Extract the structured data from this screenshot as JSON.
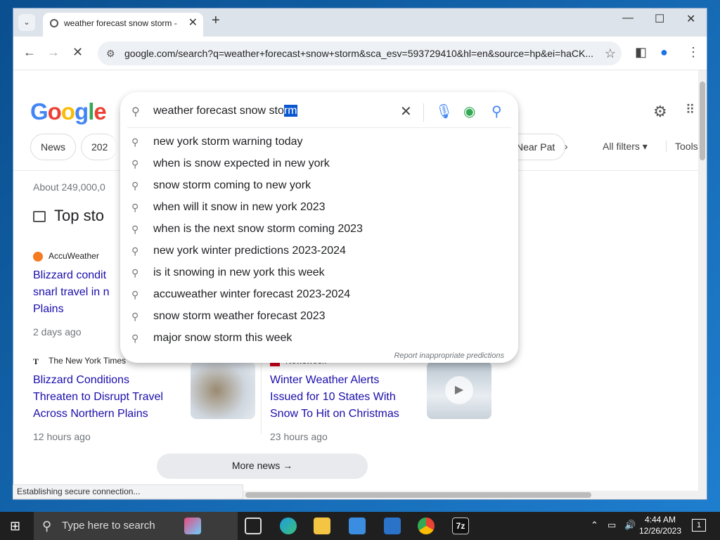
{
  "browser": {
    "tab_title": "weather forecast snow storm -",
    "tab_close": "✕",
    "new_tab": "+",
    "url": "google.com/search?q=weather+forecast+snow+storm&sca_esv=593729410&hl=en&source=hp&ei=haCK..."
  },
  "google": {
    "logo": "Google",
    "query_prefix": "weather forecast snow sto",
    "query_selected": "rm",
    "chips": [
      "News",
      "202"
    ],
    "chip_right": "Near Pat",
    "all_filters": "All filters",
    "tools": "Tools",
    "stats": "About 249,000,0",
    "top_stories": "Top sto",
    "suggestions": [
      "new york storm warning today",
      "when is snow expected in new york",
      "snow storm coming to new york",
      "when will it snow in new york 2023",
      "when is the next snow storm coming 2023",
      "new york winter predictions 2023-2024",
      "is it snowing in new york this week",
      "accuweather winter forecast 2023-2024",
      "snow storm weather forecast 2023",
      "major snow storm this week"
    ],
    "report": "Report inappropriate predictions",
    "stories": [
      {
        "source": "AccuWeather",
        "headline": "Blizzard condit snarl travel in n Plains",
        "age": "2 days ago"
      },
      {
        "source": "The New York Times",
        "headline": "Blizzard Conditions Threaten to Disrupt Travel Across Northern Plains",
        "age": "12 hours ago"
      },
      {
        "source": "Newsweek",
        "headline": "Winter Weather Alerts Issued for 10 States With Snow To Hit on Christmas",
        "age": "23 hours ago"
      }
    ],
    "more_news": "More news"
  },
  "status_text": "Establishing secure connection...",
  "taskbar": {
    "search_placeholder": "Type here to search",
    "time": "4:44 AM",
    "date": "12/26/2023",
    "notif_count": "1"
  }
}
